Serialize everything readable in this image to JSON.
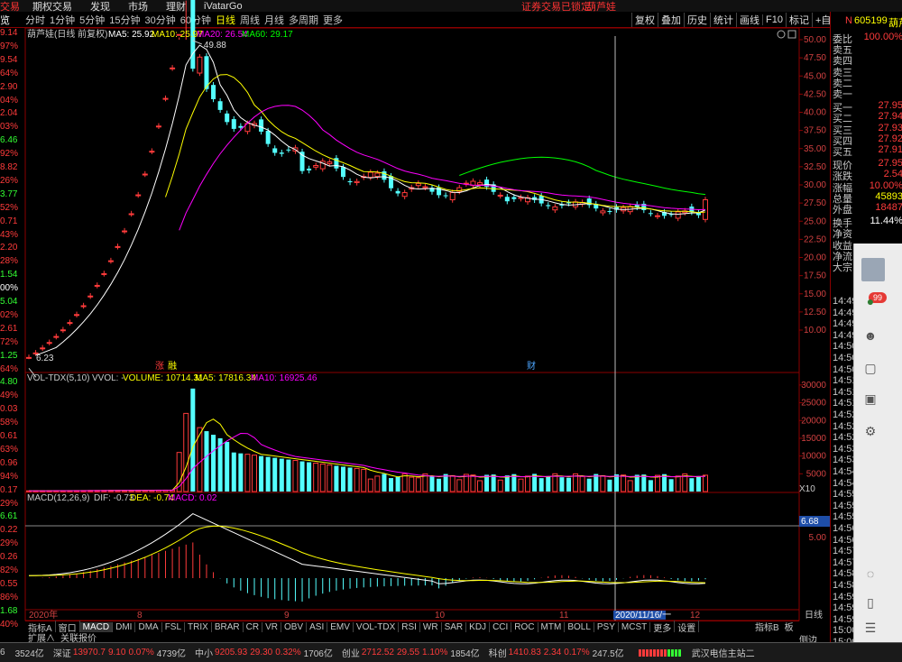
{
  "topbar": {
    "items": [
      "交易",
      "期权交易",
      "发现",
      "市场",
      "理财",
      "iVatarGo"
    ],
    "notice": "证券交易已锁定",
    "stock_name": "葫芦娃"
  },
  "period_bar": {
    "left_fragment": "览",
    "periods": [
      "分时",
      "1分钟",
      "5分钟",
      "15分钟",
      "30分钟",
      "60分钟",
      "日线",
      "周线",
      "月线",
      "多周期",
      "更多"
    ],
    "active": "日线",
    "tools": [
      "复权",
      "叠加",
      "历史",
      "统计",
      "画线",
      "F10",
      "标记",
      "+自选",
      "返回"
    ]
  },
  "main_chart": {
    "stock_label": "葫芦娃(日线 前复权)",
    "ma5_label": "MA5: 25.92",
    "ma10_label": "MA10: 25.97",
    "ma20_label": "MA20: 26.54",
    "ma60_label": "MA60: 29.17",
    "high_marker": "49.88",
    "low_marker": "6.23",
    "event_tags": [
      "涨",
      "融"
    ],
    "fin_tag": "财",
    "price_axis": [
      "50.00",
      "47.50",
      "45.00",
      "42.50",
      "40.00",
      "37.50",
      "35.00",
      "32.50",
      "30.00",
      "27.50",
      "25.00",
      "22.50",
      "20.00",
      "17.50",
      "15.00",
      "12.50",
      "10.00"
    ]
  },
  "volume_chart": {
    "label": "VOL-TDX(5,10)",
    "vvol": "VVOL: -",
    "volume": "VOLUME: 10714.31",
    "ma5": "MA5: 17816.34",
    "ma10": "MA10: 16925.46",
    "axis": [
      "30000",
      "25000",
      "20000",
      "15000",
      "10000",
      "5000"
    ],
    "unit": "X10"
  },
  "macd_chart": {
    "label": "MACD(12,26,9)",
    "dif": "DIF: -0.73",
    "dea": "DEA: -0.74",
    "macd": "MACD: 0.02",
    "marker_value": "6.68",
    "axis": [
      "5.00"
    ]
  },
  "date_axis": {
    "labels": [
      "2020年",
      "8",
      "9",
      "10",
      "11",
      "12"
    ],
    "cursor_date": "2020/11/16/一",
    "right_label": "日线"
  },
  "left_strip": [
    {
      "v": "9.14",
      "c": "red"
    },
    {
      "v": "97%",
      "c": "red"
    },
    {
      "v": "9.54",
      "c": "red"
    },
    {
      "v": "64%",
      "c": "red"
    },
    {
      "v": "2.90",
      "c": "red"
    },
    {
      "v": "04%",
      "c": "red"
    },
    {
      "v": "2.04",
      "c": "red"
    },
    {
      "v": "03%",
      "c": "red"
    },
    {
      "v": "6.46",
      "c": "green"
    },
    {
      "v": "92%",
      "c": "red"
    },
    {
      "v": "8.82",
      "c": "red"
    },
    {
      "v": "26%",
      "c": "red"
    },
    {
      "v": "3.77",
      "c": "green"
    },
    {
      "v": "52%",
      "c": "red"
    },
    {
      "v": "0.71",
      "c": "red"
    },
    {
      "v": "43%",
      "c": "red"
    },
    {
      "v": "2.20",
      "c": "red"
    },
    {
      "v": "28%",
      "c": "red"
    },
    {
      "v": "1.54",
      "c": "green"
    },
    {
      "v": "00%",
      "c": "white"
    },
    {
      "v": "5.04",
      "c": "green"
    },
    {
      "v": "02%",
      "c": "red"
    },
    {
      "v": "2.61",
      "c": "red"
    },
    {
      "v": "72%",
      "c": "red"
    },
    {
      "v": "1.25",
      "c": "green"
    },
    {
      "v": "64%",
      "c": "red"
    },
    {
      "v": "4.80",
      "c": "green"
    },
    {
      "v": "49%",
      "c": "red"
    },
    {
      "v": "0.03",
      "c": "red"
    },
    {
      "v": "58%",
      "c": "red"
    },
    {
      "v": "0.61",
      "c": "red"
    },
    {
      "v": "63%",
      "c": "red"
    },
    {
      "v": "0.96",
      "c": "red"
    },
    {
      "v": "94%",
      "c": "red"
    },
    {
      "v": "0.17",
      "c": "red"
    },
    {
      "v": "29%",
      "c": "red"
    },
    {
      "v": "6.61",
      "c": "green"
    },
    {
      "v": "0.22",
      "c": "red"
    },
    {
      "v": "29%",
      "c": "red"
    },
    {
      "v": "0.26",
      "c": "red"
    },
    {
      "v": "82%",
      "c": "red"
    },
    {
      "v": "0.55",
      "c": "red"
    },
    {
      "v": "86%",
      "c": "red"
    },
    {
      "v": "1.68",
      "c": "green"
    },
    {
      "v": "40%",
      "c": "red"
    }
  ],
  "quote_panel": {
    "header_n": "N",
    "code": "605199",
    "name": "葫芦",
    "rows": [
      {
        "label": "委比",
        "value": "100.00%",
        "style": "red"
      },
      {
        "label": "卖五",
        "value": "",
        "style": "red"
      },
      {
        "label": "卖四",
        "value": "",
        "style": "red"
      },
      {
        "label": "卖三",
        "value": "",
        "style": "red"
      },
      {
        "label": "卖二",
        "value": "",
        "style": "red"
      },
      {
        "label": "卖一",
        "value": "",
        "style": "red"
      },
      {
        "label": "买一",
        "value": "27.95",
        "style": "red"
      },
      {
        "label": "买二",
        "value": "27.94",
        "style": "red"
      },
      {
        "label": "买三",
        "value": "27.93",
        "style": "red"
      },
      {
        "label": "买四",
        "value": "27.92",
        "style": "red"
      },
      {
        "label": "买五",
        "value": "27.91",
        "style": "red"
      },
      {
        "label": "现价",
        "value": "27.95",
        "style": "red"
      },
      {
        "label": "涨跌",
        "value": "2.54",
        "style": "red"
      },
      {
        "label": "涨幅",
        "value": "10.00%",
        "style": "red"
      },
      {
        "label": "总量",
        "value": "45893",
        "style": "yellow"
      },
      {
        "label": "外盘",
        "value": "18487",
        "style": "red"
      },
      {
        "label": "换手",
        "value": "11.44%",
        "style": "white"
      },
      {
        "label": "净资",
        "value": "",
        "style": "white"
      },
      {
        "label": "收益",
        "value": "",
        "style": "white"
      },
      {
        "label": "净流",
        "value": "",
        "style": "white"
      },
      {
        "label": "大宗",
        "value": "",
        "style": "white"
      }
    ],
    "times": [
      "14:49",
      "14:49",
      "14:49",
      "14:49",
      "14:50",
      "14:50",
      "14:50",
      "14:51",
      "14:51",
      "14:51",
      "14:52",
      "14:52",
      "14:52",
      "14:53",
      "14:53",
      "14:54",
      "14:54",
      "14:55",
      "14:55",
      "14:55",
      "14:56",
      "14:56",
      "14:57",
      "14:57",
      "14:58",
      "14:58",
      "14:59",
      "14:59",
      "14:59",
      "15:00",
      "15:00"
    ]
  },
  "overlay": {
    "badge": "99"
  },
  "indicator_bar": {
    "items": [
      "指标A",
      "窗口",
      "MACD",
      "DMI",
      "DMA",
      "FSL",
      "TRIX",
      "BRAR",
      "CR",
      "VR",
      "OBV",
      "ASI",
      "EMV",
      "VOL-TDX",
      "RSI",
      "WR",
      "SAR",
      "KDJ",
      "CCI",
      "ROC",
      "MTM",
      "BOLL",
      "PSY",
      "MCST",
      "更多",
      "设置"
    ],
    "active": "MACD",
    "right": [
      "指标B",
      "板"
    ]
  },
  "ext_bar": {
    "items": [
      "扩展∧",
      "关联报价"
    ],
    "side": "侧边栏»"
  },
  "status_bar": {
    "groups": [
      {
        "label": "6",
        "value": "",
        "change": "",
        "pct": "",
        "amount": "3524亿"
      },
      {
        "label": "深证",
        "value": "13970.7",
        "change": "9.10",
        "pct": "0.07%",
        "amount": "4739亿"
      },
      {
        "label": "中小",
        "value": "9205.93",
        "change": "29.30",
        "pct": "0.32%",
        "amount": "1706亿"
      },
      {
        "label": "创业",
        "value": "2712.52",
        "change": "29.55",
        "pct": "1.10%",
        "amount": "1854亿"
      },
      {
        "label": "科创",
        "value": "1410.83",
        "change": "2.34",
        "pct": "0.17%",
        "amount": "247.5亿"
      }
    ],
    "station": "武汉电信主站二"
  },
  "colors": {
    "up": "#ff3b3b",
    "down": "#54ffff",
    "ma5": "#ffffff",
    "ma10": "#ffff00",
    "ma20": "#ff00ff",
    "ma60": "#00ff00",
    "grid": "#8b0000"
  }
}
